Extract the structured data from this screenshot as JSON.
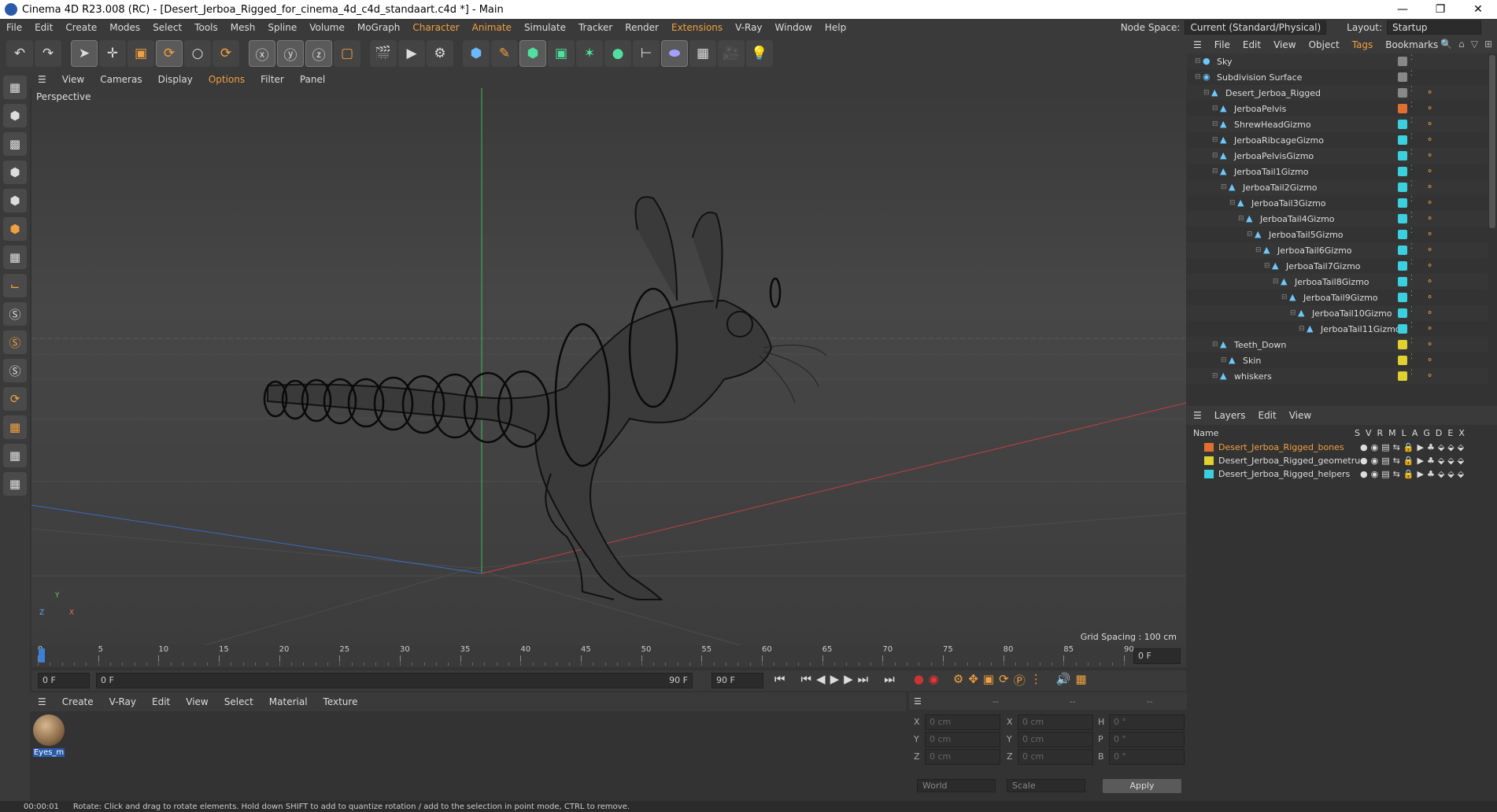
{
  "titlebar": {
    "title": "Cinema 4D R23.008 (RC) - [Desert_Jerboa_Rigged_for_cinema_4d_c4d_standaart.c4d *] - Main"
  },
  "menu": [
    "File",
    "Edit",
    "Create",
    "Modes",
    "Select",
    "Tools",
    "Mesh",
    "Spline",
    "Volume",
    "MoGraph",
    "Character",
    "Animate",
    "Simulate",
    "Tracker",
    "Render",
    "Extensions",
    "V-Ray",
    "Window",
    "Help"
  ],
  "nodespace": {
    "label": "Node Space:",
    "value": "Current (Standard/Physical)",
    "layout_label": "Layout:",
    "layout_value": "Startup"
  },
  "viewport_menu": [
    "View",
    "Cameras",
    "Display",
    "Options",
    "Filter",
    "Panel"
  ],
  "viewport": {
    "name": "Perspective",
    "grid_spacing": "Grid Spacing : 100 cm"
  },
  "timeline": {
    "ticks": [
      "0",
      "5",
      "10",
      "15",
      "20",
      "25",
      "30",
      "35",
      "40",
      "45",
      "50",
      "55",
      "60",
      "65",
      "70",
      "75",
      "80",
      "85",
      "90"
    ],
    "current_frame": "0 F"
  },
  "transport": {
    "start": "0 F",
    "range_start": "0 F",
    "range_end": "90 F",
    "end": "90 F"
  },
  "material_menu": [
    "Create",
    "V-Ray",
    "Edit",
    "View",
    "Select",
    "Material",
    "Texture"
  ],
  "material": {
    "name": "Eyes_m"
  },
  "attributes": {
    "header": [
      "--",
      "--",
      "--"
    ],
    "rows": [
      {
        "a": "X",
        "av": "0 cm",
        "b": "X",
        "bv": "0 cm",
        "c": "H",
        "cv": "0 °"
      },
      {
        "a": "Y",
        "av": "0 cm",
        "b": "Y",
        "bv": "0 cm",
        "c": "P",
        "cv": "0 °"
      },
      {
        "a": "Z",
        "av": "0 cm",
        "b": "Z",
        "bv": "0 cm",
        "c": "B",
        "cv": "0 °"
      }
    ],
    "coord": "World",
    "mode": "Scale",
    "apply": "Apply"
  },
  "object_menu": [
    "File",
    "Edit",
    "View",
    "Object",
    "Tags",
    "Bookmarks"
  ],
  "objects": [
    {
      "name": "Sky",
      "indent": 0,
      "color": "#888888"
    },
    {
      "name": "Subdivision Surface",
      "indent": 0,
      "color": "#888888"
    },
    {
      "name": "Desert_Jerboa_Rigged",
      "indent": 1,
      "color": "#888888"
    },
    {
      "name": "JerboaPelvis",
      "indent": 2,
      "color": "#e07030"
    },
    {
      "name": "ShrewHeadGizmo",
      "indent": 2,
      "color": "#3ad0e0"
    },
    {
      "name": "JerboaRibcageGizmo",
      "indent": 2,
      "color": "#3ad0e0"
    },
    {
      "name": "JerboaPelvisGizmo",
      "indent": 2,
      "color": "#3ad0e0"
    },
    {
      "name": "JerboaTail1Gizmo",
      "indent": 2,
      "color": "#3ad0e0"
    },
    {
      "name": "JerboaTail2Gizmo",
      "indent": 3,
      "color": "#3ad0e0"
    },
    {
      "name": "JerboaTail3Gizmo",
      "indent": 4,
      "color": "#3ad0e0"
    },
    {
      "name": "JerboaTail4Gizmo",
      "indent": 5,
      "color": "#3ad0e0"
    },
    {
      "name": "JerboaTail5Gizmo",
      "indent": 6,
      "color": "#3ad0e0"
    },
    {
      "name": "JerboaTail6Gizmo",
      "indent": 7,
      "color": "#3ad0e0"
    },
    {
      "name": "JerboaTail7Gizmo",
      "indent": 8,
      "color": "#3ad0e0"
    },
    {
      "name": "JerboaTail8Gizmo",
      "indent": 9,
      "color": "#3ad0e0"
    },
    {
      "name": "JerboaTail9Gizmo",
      "indent": 10,
      "color": "#3ad0e0"
    },
    {
      "name": "JerboaTail10Gizmo",
      "indent": 11,
      "color": "#3ad0e0"
    },
    {
      "name": "JerboaTail11Gizmo",
      "indent": 12,
      "color": "#3ad0e0"
    },
    {
      "name": "Teeth_Down",
      "indent": 2,
      "color": "#e0d030"
    },
    {
      "name": "Skin",
      "indent": 3,
      "color": "#e0d030"
    },
    {
      "name": "whiskers",
      "indent": 2,
      "color": "#e0d030"
    }
  ],
  "layer_menu": [
    "Layers",
    "Edit",
    "View"
  ],
  "layer_header": {
    "name": "Name",
    "cols": [
      "S",
      "V",
      "R",
      "M",
      "L",
      "A",
      "G",
      "D",
      "E",
      "X"
    ]
  },
  "layers": [
    {
      "name": "Desert_Jerboa_Rigged_bones",
      "color": "#e07030",
      "text_color": "#f0a040"
    },
    {
      "name": "Desert_Jerboa_Rigged_geometru",
      "color": "#e0d030",
      "text_color": "#dddddd"
    },
    {
      "name": "Desert_Jerboa_Rigged_helpers",
      "color": "#3ad0e0",
      "text_color": "#dddddd"
    }
  ],
  "statusbar": {
    "time": "00:00:01",
    "message": "Rotate: Click and drag to rotate elements. Hold down SHIFT to add to quantize rotation / add to the selection in point mode, CTRL to remove."
  }
}
